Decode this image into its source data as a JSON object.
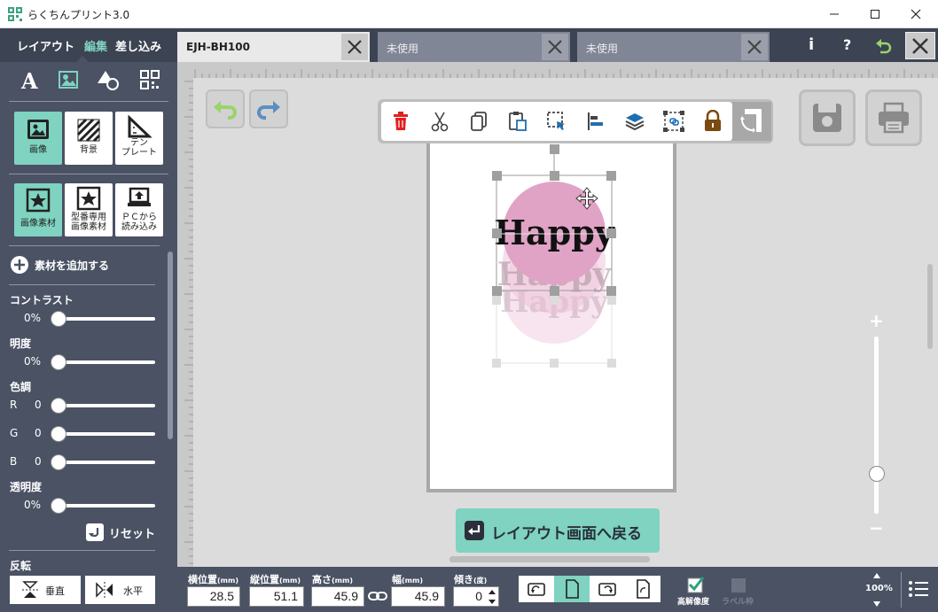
{
  "window": {
    "title": "らくちんプリント3.0",
    "minimize": "—",
    "maximize": "☐",
    "close": "✕"
  },
  "mode_tabs": [
    {
      "label": "レイアウト",
      "active": false
    },
    {
      "label": "編集",
      "active": true
    },
    {
      "label": "差し込み",
      "active": false
    }
  ],
  "tool_tiles_row1": [
    {
      "label": "画像",
      "icon": "image-icon",
      "active": true
    },
    {
      "label": "背景",
      "icon": "background-stripes-icon",
      "active": false
    },
    {
      "label": "テン\nプレート",
      "icon": "template-ruler-icon",
      "active": false
    }
  ],
  "tool_tiles_row2": [
    {
      "label": "画像素材",
      "icon": "star-frame-icon",
      "active": true
    },
    {
      "label": "型番専用\n画像素材",
      "icon": "star-frame-icon",
      "active": false
    },
    {
      "label": "ＰＣから\n読み込み",
      "icon": "laptop-upload-icon",
      "active": false
    }
  ],
  "add_material": "素材を追加する",
  "adjust": {
    "contrast_label": "コントラスト",
    "contrast_value": "0%",
    "brightness_label": "明度",
    "brightness_value": "0%",
    "tone_label": "色調",
    "r_label": "R",
    "r_value": "0",
    "g_label": "G",
    "g_value": "0",
    "b_label": "B",
    "b_value": "0",
    "opacity_label": "透明度",
    "opacity_value": "0%",
    "reset_label": "リセット"
  },
  "flip": {
    "label": "反転",
    "vertical": "垂直",
    "horizontal": "水平"
  },
  "doc_tabs": [
    {
      "label": "EJH-BH100",
      "active": true
    },
    {
      "label": "未使用",
      "active": false
    },
    {
      "label": "未使用",
      "active": false
    }
  ],
  "top_right": {
    "info": "i",
    "help": "?"
  },
  "canvas": {
    "image_text": "Happy",
    "back_button": "レイアウト画面へ戻る",
    "zoom_plus": "+",
    "zoom_minus": "−"
  },
  "status": {
    "x_label": "横位置",
    "x_unit": "(mm)",
    "x_value": "28.5",
    "y_label": "縦位置",
    "y_unit": "(mm)",
    "y_value": "51.1",
    "h_label": "高さ",
    "h_unit": "(mm)",
    "h_value": "45.9",
    "w_label": "幅",
    "w_unit": "(mm)",
    "w_value": "45.9",
    "tilt_label": "傾き",
    "tilt_unit": "(度)",
    "tilt_value": "0",
    "hires_label": "高解像度",
    "frame_label": "ラベル枠",
    "zoom_value": "100%"
  },
  "colors": {
    "accent": "#7fd3c0",
    "panel": "#4a5264",
    "dark_panel": "#3c4352",
    "circle_pink": "#e0a3c6",
    "delete_red": "#e02020",
    "lock_brown": "#7a4a10"
  }
}
